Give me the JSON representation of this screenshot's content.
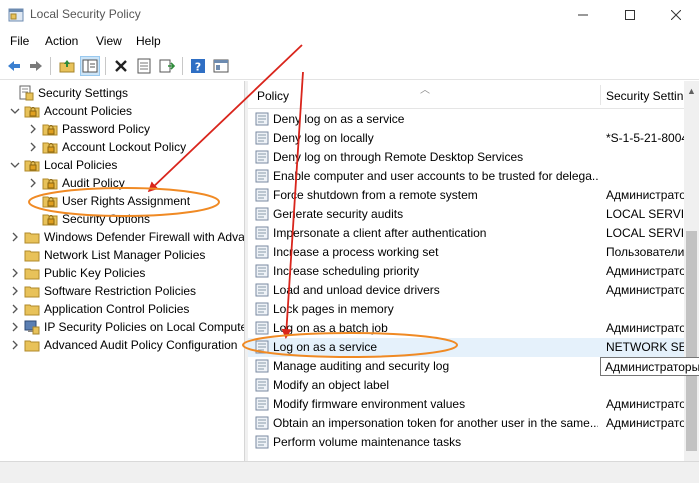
{
  "window": {
    "title": "Local Security Policy"
  },
  "menu": [
    "File",
    "Action",
    "View",
    "Help"
  ],
  "toolbar": {
    "icons": [
      "back-arrow-icon",
      "forward-arrow-icon",
      "up-folder-icon",
      "show-tree-icon",
      "delete-icon",
      "properties-icon",
      "export-list-icon",
      "help-icon",
      "console-icon"
    ]
  },
  "tree": {
    "root": "Security Settings",
    "account_policies": "Account Policies",
    "password_policy": "Password Policy",
    "account_lockout_policy": "Account Lockout Policy",
    "local_policies": "Local Policies",
    "audit_policy": "Audit Policy",
    "user_rights_assignment": "User Rights Assignment",
    "security_options": "Security Options",
    "defender_firewall": "Windows Defender Firewall with Adva",
    "network_list": "Network List Manager Policies",
    "public_key": "Public Key Policies",
    "software_restriction": "Software Restriction Policies",
    "application_control": "Application Control Policies",
    "ip_security": "IP Security Policies on Local Compute",
    "advanced_audit": "Advanced Audit Policy Configuration"
  },
  "list": {
    "col_policy": "Policy",
    "col_setting": "Security Settin",
    "rows": [
      {
        "name": "Deny log on as a service",
        "value": ""
      },
      {
        "name": "Deny log on locally",
        "value": "*S-1-5-21-8004"
      },
      {
        "name": "Deny log on through Remote Desktop Services",
        "value": ""
      },
      {
        "name": "Enable computer and user accounts to be trusted for delega...",
        "value": ""
      },
      {
        "name": "Force shutdown from a remote system",
        "value": "Администрато"
      },
      {
        "name": "Generate security audits",
        "value": "LOCAL SERVICE"
      },
      {
        "name": "Impersonate a client after authentication",
        "value": "LOCAL SERVICE"
      },
      {
        "name": "Increase a process working set",
        "value": "Пользователи"
      },
      {
        "name": "Increase scheduling priority",
        "value": "Администрато"
      },
      {
        "name": "Load and unload device drivers",
        "value": "Администрато"
      },
      {
        "name": "Lock pages in memory",
        "value": ""
      },
      {
        "name": "Log on as a batch job",
        "value": "Администрато"
      },
      {
        "name": "Log on as a service",
        "value": "NETWORK SERV"
      },
      {
        "name": "Manage auditing and security log",
        "value": ""
      },
      {
        "name": "Modify an object label",
        "value": ""
      },
      {
        "name": "Modify firmware environment values",
        "value": "Администрато"
      },
      {
        "name": "Obtain an impersonation token for another user in the same...",
        "value": "Администрато"
      },
      {
        "name": "Perform volume maintenance tasks",
        "value": ""
      }
    ]
  },
  "tooltip": "Администраторы",
  "colors": {
    "annotation_red": "#d9251c",
    "annotation_orange": "#f08a24",
    "folder_yellow": "#e8c25a",
    "selected_row": "#e5f1fb"
  }
}
